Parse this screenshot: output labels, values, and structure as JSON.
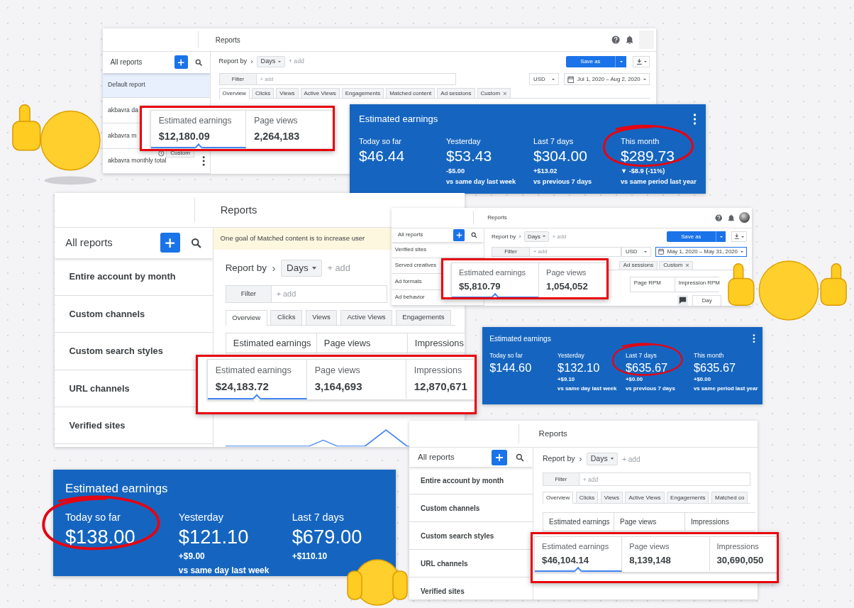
{
  "panels": [
    {
      "kind": "report_window",
      "title": "Reports",
      "header_icons": true,
      "avatar": {
        "kind": "blank"
      },
      "sidebar": {
        "title": "All reports",
        "items": [
          {
            "label": "Default report",
            "selected": true
          },
          {
            "label": "akbavra da",
            "selected": false
          },
          {
            "label": "akbavra m",
            "selected": false
          },
          {
            "label": "akbavra monthly total",
            "selected": false,
            "chip": "Custom",
            "menu": true
          }
        ]
      },
      "report_by": {
        "label": "Report by",
        "separator": "›",
        "value": "Days",
        "add": "+ add"
      },
      "save_button": "Save as",
      "download": true,
      "filter": {
        "label": "Filter",
        "placeholder": "+ add"
      },
      "currency": "USD",
      "date_range": "Jul 1, 2020 – Aug 2, 2020",
      "tabs": [
        {
          "label": "Overview",
          "selected": true
        },
        {
          "label": "Clicks",
          "selected": false
        },
        {
          "label": "Views",
          "selected": false
        },
        {
          "label": "Active Views",
          "selected": false
        },
        {
          "label": "Engagements",
          "selected": false
        },
        {
          "label": "Matched content",
          "selected": false
        },
        {
          "label": "Ad sessions",
          "selected": false
        },
        {
          "label": "Custom",
          "selected": false,
          "close": "×"
        }
      ]
    },
    {
      "kind": "metric_highlight",
      "metrics": [
        {
          "label": "Estimated earnings",
          "value": "$12,180.09",
          "selected": true
        },
        {
          "label": "Page views",
          "value": "2,264,183",
          "selected": false
        }
      ]
    },
    {
      "kind": "earnings_card",
      "title": "Estimated earnings",
      "menu": true,
      "stats": [
        {
          "label": "Today so far",
          "value": "$46.44",
          "circled": false
        },
        {
          "label": "Yesterday",
          "value": "$53.43",
          "change": "-$5.00",
          "note": "vs same day last week",
          "circled": false
        },
        {
          "label": "Last 7 days",
          "value": "$304.00",
          "change": "+$13.02",
          "note": "vs previous 7 days",
          "circled": false
        },
        {
          "label": "This month",
          "value": "$289.73",
          "change": "▼ -$8.9 (-11%)",
          "note": "vs same period last year",
          "circled": true
        }
      ]
    },
    {
      "kind": "report_window",
      "title": "Reports",
      "sidebar": {
        "title": "All reports",
        "items": [
          {
            "label": "Entire account by month",
            "selected": false
          },
          {
            "label": "Custom channels",
            "selected": false
          },
          {
            "label": "Custom search styles",
            "selected": false
          },
          {
            "label": "URL channels",
            "selected": false
          },
          {
            "label": "Verified sites",
            "selected": false
          }
        ]
      },
      "banner": "One goal of Matched content is to increase user",
      "report_by": {
        "label": "Report by",
        "separator": "›",
        "value": "Days",
        "add": "+ add"
      },
      "filter": {
        "label": "Filter",
        "placeholder": "+ add"
      },
      "tabs": [
        {
          "label": "Overview",
          "selected": true
        },
        {
          "label": "Clicks",
          "selected": false
        },
        {
          "label": "Views",
          "selected": false
        },
        {
          "label": "Active Views",
          "selected": false
        },
        {
          "label": "Engagements",
          "selected": false
        }
      ],
      "metric_headers": [
        "Estimated earnings",
        "Page views",
        "Impressions"
      ],
      "chart": {
        "kind": "line"
      }
    },
    {
      "kind": "report_window",
      "title": "Reports",
      "header_icons": true,
      "avatar": {
        "kind": "photo"
      },
      "sidebar": {
        "title": "All reports",
        "items": [
          {
            "label": "Verified sites",
            "selected": false
          },
          {
            "label": "Served creatives",
            "selected": false
          },
          {
            "label": "Ad formats",
            "selected": false
          },
          {
            "label": "Ad behavior",
            "selected": false
          }
        ]
      },
      "report_by": {
        "label": "Report by",
        "separator": "›",
        "value": "Days",
        "add": "+ add"
      },
      "save_button": "Save as",
      "download": true,
      "filter": {
        "label": "Filter",
        "placeholder": "+ add"
      },
      "currency": "USD",
      "date_range": "May 1, 2020 – May 31, 2020",
      "tabs": [
        {
          "label": "Ad sessions",
          "selected": false
        },
        {
          "label": "Custom",
          "selected": false,
          "close": "×"
        }
      ],
      "metric_headers": [
        "Page RPM",
        "Impression RPM"
      ],
      "period_toggle": [
        {
          "label": "Day",
          "selected": false
        }
      ]
    },
    {
      "kind": "metric_highlight",
      "metrics": [
        {
          "label": "Estimated earnings",
          "value": "$5,810.79",
          "selected": true
        },
        {
          "label": "Page views",
          "value": "1,054,052",
          "selected": false
        }
      ]
    },
    {
      "kind": "metric_highlight",
      "metrics": [
        {
          "label": "Estimated earnings",
          "value": "$24,183.72",
          "selected": true
        },
        {
          "label": "Page views",
          "value": "3,164,693",
          "selected": false
        },
        {
          "label": "Impressions",
          "value": "12,870,671",
          "selected": false
        }
      ]
    },
    {
      "kind": "earnings_card",
      "title": "Estimated earnings",
      "menu": true,
      "stats": [
        {
          "label": "Today so far",
          "value": "$144.60",
          "circled": false
        },
        {
          "label": "Yesterday",
          "value": "$132.10",
          "change": "+$9.10",
          "note": "vs same day last week",
          "circled": false
        },
        {
          "label": "Last 7 days",
          "value": "$635.67",
          "change": "+$0.00",
          "note": "vs previous 7 days",
          "circled": true
        },
        {
          "label": "This month",
          "value": "$635.67",
          "change": "+$0.00",
          "note": "vs same period last year",
          "circled": false
        }
      ]
    },
    {
      "kind": "report_window",
      "title": "Reports",
      "sidebar": {
        "title": "All reports",
        "items": [
          {
            "label": "Entire account by month",
            "selected": false
          },
          {
            "label": "Custom channels",
            "selected": false
          },
          {
            "label": "Custom search styles",
            "selected": false
          },
          {
            "label": "URL channels",
            "selected": false
          },
          {
            "label": "Verified sites",
            "selected": false
          }
        ]
      },
      "report_by": {
        "label": "Report by",
        "separator": "›",
        "value": "Days",
        "add": "+ add"
      },
      "filter": {
        "label": "Filter",
        "placeholder": "+ add"
      },
      "tabs": [
        {
          "label": "Overview",
          "selected": true
        },
        {
          "label": "Clicks",
          "selected": false
        },
        {
          "label": "Views",
          "selected": false
        },
        {
          "label": "Active Views",
          "selected": false
        },
        {
          "label": "Engagements",
          "selected": false
        },
        {
          "label": "Matched co",
          "selected": false
        }
      ],
      "metric_headers": [
        "Estimated earnings",
        "Page views",
        "Impressions"
      ]
    },
    {
      "kind": "metric_highlight",
      "metrics": [
        {
          "label": "Estimated earnings",
          "value": "$46,104.14",
          "selected": true
        },
        {
          "label": "Page views",
          "value": "8,139,148",
          "selected": false
        },
        {
          "label": "Impressions",
          "value": "30,690,050",
          "selected": false
        }
      ]
    },
    {
      "kind": "earnings_card",
      "title": "Estimated earnings",
      "stats": [
        {
          "label": "Today so far",
          "value": "$138.00",
          "circled": true
        },
        {
          "label": "Yesterday",
          "value": "$121.10",
          "change": "+$9.00",
          "note": "vs same day last week",
          "circled": false
        },
        {
          "label": "Last 7 days",
          "value": "$679.00",
          "change": "+$110.10",
          "circled": false
        }
      ]
    }
  ]
}
